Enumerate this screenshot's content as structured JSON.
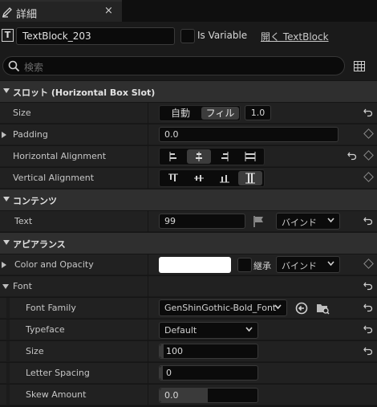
{
  "tab": {
    "title": "詳細",
    "close": "×"
  },
  "header": {
    "widget_name": "TextBlock_203",
    "type_icon": "T",
    "is_variable_label": "Is Variable",
    "open_link": "開く TextBlock"
  },
  "search": {
    "placeholder": "検索"
  },
  "slot": {
    "category": "スロット (Horizontal Box Slot)",
    "size_label": "Size",
    "size_auto": "自動",
    "size_fill": "フィル",
    "size_value": "1.0",
    "padding_label": "Padding",
    "padding_value": "0.0",
    "halign_label": "Horizontal Alignment",
    "valign_label": "Vertical Alignment"
  },
  "content": {
    "category": "コンテンツ",
    "text_label": "Text",
    "text_value": "99",
    "bind_label": "バインド"
  },
  "appearance": {
    "category": "アピアランス",
    "color_label": "Color and Opacity",
    "inherit_label": "継承",
    "bind_label": "バインド",
    "font_label": "Font",
    "font_family_label": "Font Family",
    "font_family_value": "GenShinGothic-Bold_Font",
    "typeface_label": "Typeface",
    "typeface_value": "Default",
    "size_label": "Size",
    "size_value": "100",
    "letter_spacing_label": "Letter Spacing",
    "letter_spacing_value": "0",
    "skew_label": "Skew Amount",
    "skew_value": "0.0"
  },
  "colors": {
    "bg": "#151515",
    "row": "#212121",
    "category": "#2f2f2f",
    "field": "#0b0b0b",
    "swatch": "#ffffff"
  }
}
